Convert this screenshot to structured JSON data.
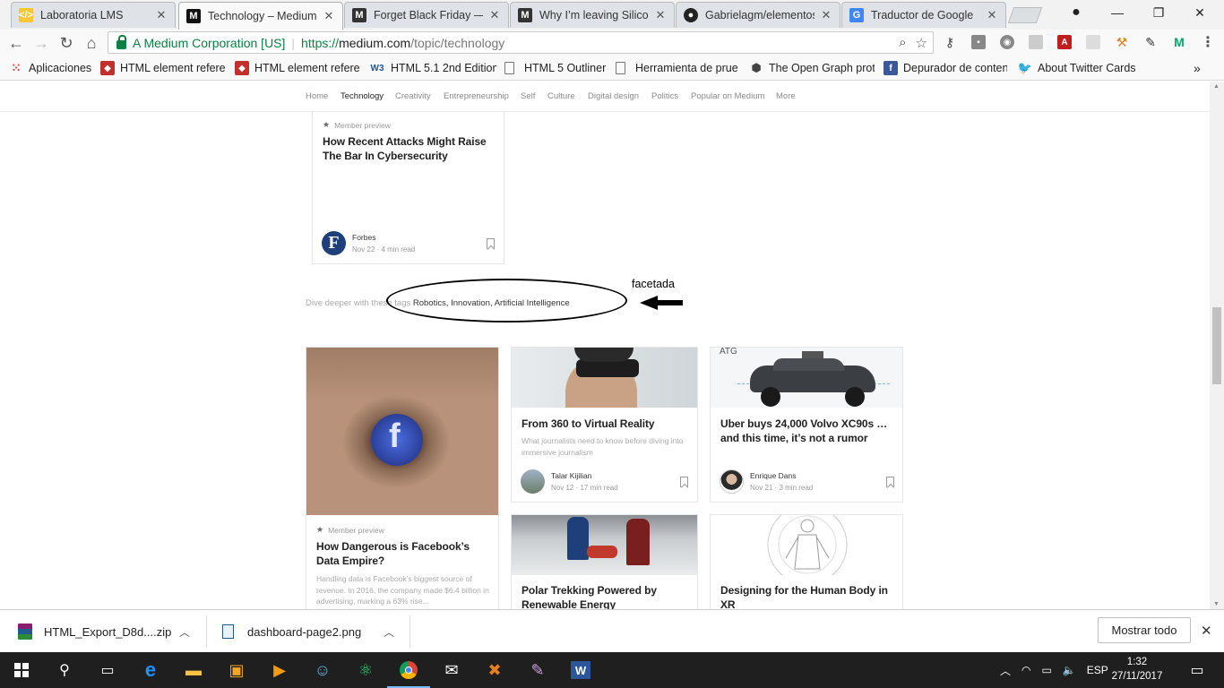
{
  "browser": {
    "tabs": [
      {
        "title": "Laboratoria LMS",
        "favicon": "laboratoria-icon",
        "active": false
      },
      {
        "title": "Technology – Medium",
        "favicon": "medium-icon",
        "active": true
      },
      {
        "title": "Forget Black Friday — H",
        "favicon": "medium-icon",
        "active": false
      },
      {
        "title": "Why I’m leaving Silicon",
        "favicon": "medium-icon",
        "active": false
      },
      {
        "title": "Gabrielagm/elementos",
        "favicon": "github-icon",
        "active": false
      },
      {
        "title": "Traductor de Google",
        "favicon": "google-translate-icon",
        "active": false
      }
    ],
    "omnibox": {
      "ev_name": "A Medium Corporation [US]",
      "url_proto": "https://",
      "url_host": "medium.com",
      "url_path": "/topic/technology"
    },
    "bookmarks": [
      {
        "label": "Aplicaciones",
        "icon": "apps-grid-icon"
      },
      {
        "label": "HTML element refere",
        "icon": "mdn-icon"
      },
      {
        "label": "HTML element refere",
        "icon": "mdn-icon"
      },
      {
        "label": "HTML 5.1 2nd Edition",
        "icon": "w3c-icon"
      },
      {
        "label": "HTML 5 Outliner",
        "icon": "page-icon"
      },
      {
        "label": "Herramienta de prueb",
        "icon": "page-icon"
      },
      {
        "label": "The Open Graph prot",
        "icon": "opengraph-icon"
      },
      {
        "label": "Depurador de conten",
        "icon": "facebook-icon"
      },
      {
        "label": "About Twitter Cards -",
        "icon": "twitter-icon"
      }
    ],
    "bookmarks_overflow": "»"
  },
  "medium": {
    "topics": [
      "Home",
      "Technology",
      "Creativity",
      "Entrepreneurship",
      "Self",
      "Culture",
      "Digital design",
      "Politics",
      "Popular on Medium",
      "More"
    ],
    "current_topic": "Technology",
    "top_card": {
      "preview_label": "Member preview",
      "title": "How Recent Attacks Might Raise The Bar In Cybersecurity",
      "author": "Forbes",
      "meta": "Nov 22 · 4 min read"
    },
    "tags_intro": "Dive deeper with these tags",
    "tags": "Robotics, Innovation, Artificial Intelligence",
    "annotation": "facetada",
    "cards": [
      {
        "preview_label": "Member preview",
        "title": "How Dangerous is Facebook’s Data Empire?",
        "subtitle": "Handling data is Facebook’s biggest source of revenue. In 2016, the company made $6.4 billion in advertising, marking a 63% rise..."
      },
      {
        "title": "From 360 to Virtual Reality",
        "subtitle": "What journalists need to know before diving into immersive journalism",
        "author": "Talar Kijilian",
        "meta": "Nov 12 · 17 min read"
      },
      {
        "image_label": "ATG",
        "title": "Uber buys 24,000 Volvo XC90s … and this time, it’s not a rumor",
        "author": "Enrique Dans",
        "meta": "Nov 21 · 3 min read"
      },
      {
        "title": "Polar Trekking Powered by Renewable Energy"
      },
      {
        "title": "Designing for the Human Body in XR"
      }
    ]
  },
  "downloads": {
    "items": [
      {
        "name": "HTML_Export_D8d....zip"
      },
      {
        "name": "dashboard-page2.png"
      }
    ],
    "show_all": "Mostrar todo"
  },
  "taskbar": {
    "language": "ESP",
    "time": "1:32",
    "date": "27/11/2017"
  }
}
